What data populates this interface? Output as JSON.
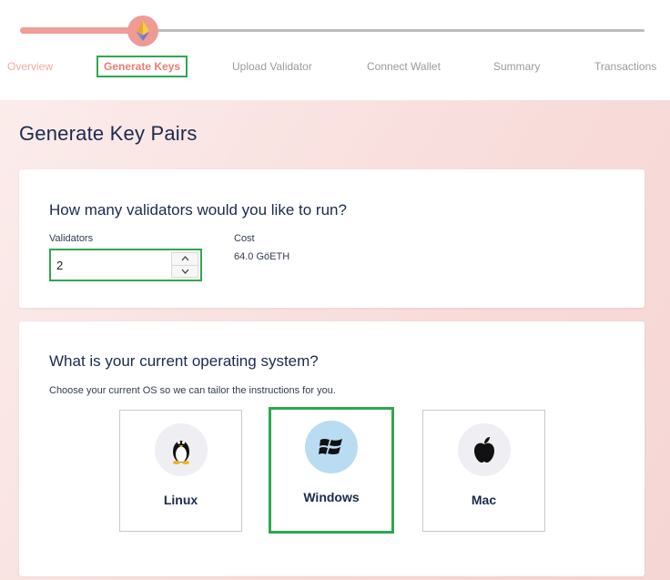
{
  "stepper": {
    "steps": [
      {
        "label": "Overview",
        "state": "done"
      },
      {
        "label": "Generate Keys",
        "state": "active"
      },
      {
        "label": "Upload Validator",
        "state": "todo"
      },
      {
        "label": "Connect Wallet",
        "state": "todo"
      },
      {
        "label": "Summary",
        "state": "todo"
      },
      {
        "label": "Transactions",
        "state": "todo"
      }
    ],
    "icon": "ethereum-icon",
    "colors": {
      "done": "#ef9d97",
      "todo": "#bdbdbd",
      "highlight": "#2fa84f"
    }
  },
  "page": {
    "title": "Generate Key Pairs"
  },
  "validators_card": {
    "heading": "How many validators would you like to run?",
    "validators_label": "Validators",
    "validators_value": "2",
    "cost_label": "Cost",
    "cost_value": "64.0 GöETH"
  },
  "os_card": {
    "heading": "What is your current operating system?",
    "subtitle": "Choose your current OS so we can tailor the instructions for you.",
    "options": [
      {
        "label": "Linux",
        "icon": "linux-penguin-icon",
        "selected": false
      },
      {
        "label": "Windows",
        "icon": "windows-icon",
        "selected": true
      },
      {
        "label": "Mac",
        "icon": "apple-icon",
        "selected": false
      }
    ]
  }
}
